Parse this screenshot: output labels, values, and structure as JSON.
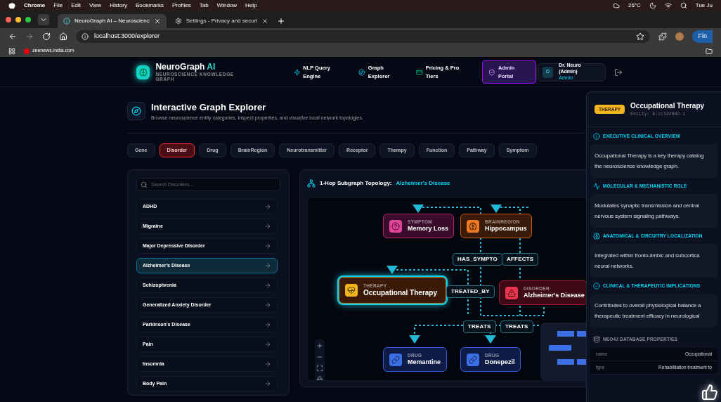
{
  "menubar": {
    "app": "Chrome",
    "items": [
      "File",
      "Edit",
      "View",
      "History",
      "Bookmarks",
      "Profiles",
      "Tab",
      "Window",
      "Help"
    ],
    "weather": "26°C",
    "clock": "Tue Ju"
  },
  "tabs": [
    {
      "title": "NeuroGraph AI – Neuroscienc",
      "selected": true
    },
    {
      "title": "Settings - Privacy and securi",
      "selected": false
    }
  ],
  "address": "localhost:3000/explorer",
  "bookmarks": [
    "zeenews.india.com"
  ],
  "profile_button": "Fin",
  "brand": {
    "name": "NeuroGraph",
    "accent": "AI",
    "tagline": "NEUROSCIENCE KNOWLEDGE GRAPH"
  },
  "nav": [
    {
      "label": "NLP Query Engine",
      "kind": "nlp"
    },
    {
      "label": "Graph Explorer",
      "kind": "graph"
    },
    {
      "label": "Pricing & Pro Tiers",
      "kind": "pricing"
    },
    {
      "label": "Admin Portal",
      "kind": "admin"
    }
  ],
  "user": {
    "initial": "D",
    "name": "Dr. Neuro (Admin)",
    "role": "Admin"
  },
  "page": {
    "title": "Interactive Graph Explorer",
    "subtitle": "Browse neuroscience entity categories, inspect properties, and visualize local network topologies."
  },
  "categories": [
    {
      "label": "Gene",
      "selected": false
    },
    {
      "label": "Disorder",
      "selected": true
    },
    {
      "label": "Drug",
      "selected": false
    },
    {
      "label": "BrainRegion",
      "selected": false
    },
    {
      "label": "Neurotransmitter",
      "selected": false
    },
    {
      "label": "Receptor",
      "selected": false
    },
    {
      "label": "Therapy",
      "selected": false
    },
    {
      "label": "Function",
      "selected": false
    },
    {
      "label": "Pathway",
      "selected": false
    },
    {
      "label": "Symptom",
      "selected": false
    }
  ],
  "search": {
    "placeholder": "Search Disorders..."
  },
  "entities": [
    {
      "name": "ADHD",
      "selected": false
    },
    {
      "name": "Migraine",
      "selected": false
    },
    {
      "name": "Major Depressive Disorder",
      "selected": false
    },
    {
      "name": "Alzheimer's Disease",
      "selected": true
    },
    {
      "name": "Schizophrenia",
      "selected": false
    },
    {
      "name": "Generalized Anxiety Disorder",
      "selected": false
    },
    {
      "name": "Parkinson's Disease",
      "selected": false
    },
    {
      "name": "Pain",
      "selected": false
    },
    {
      "name": "Insomnia",
      "selected": false
    },
    {
      "name": "Body Pain",
      "selected": false
    }
  ],
  "graph": {
    "title": "1-Hop Subgraph Topology:",
    "subject": "Alzheimer's Disease",
    "nodes": [
      {
        "type": "SYMPTOM",
        "name": "Memory Loss",
        "kind": "symptom",
        "selected": false
      },
      {
        "type": "BRAINREGION",
        "name": "Hippocampus",
        "kind": "brainregion",
        "selected": false
      },
      {
        "type": "THERAPY",
        "name": "Occupational Therapy",
        "kind": "therapy",
        "selected": true
      },
      {
        "type": "DISORDER",
        "name": "Alzheimer's Disease",
        "kind": "disorder",
        "selected": false
      },
      {
        "type": "DRUG",
        "name": "Memantine",
        "kind": "drug",
        "selected": false
      },
      {
        "type": "DRUG",
        "name": "Donepezil",
        "kind": "drug",
        "selected": false
      }
    ],
    "edge_labels": [
      "HAS_SYMPTO",
      "AFFECTS",
      "TREATED_BY",
      "TREATS",
      "TREATS"
    ]
  },
  "details": {
    "badge": "THERAPY",
    "title": "Occupational Therapy",
    "entity": "Entity: 4:cc3220d2-1",
    "sections": [
      {
        "kind": "info",
        "heading": "EXECUTIVE CLINICAL OVERVIEW",
        "lines": [
          "Occupational Therapy is a key therapy catalog",
          "the neuroscience knowledge graph."
        ]
      },
      {
        "kind": "activity",
        "heading": "MOLECULAR & MECHANISTIC ROLE",
        "lines": [
          "Modulates synaptic transmission and central",
          "nervous system signaling pathways."
        ]
      },
      {
        "kind": "brain",
        "heading": "ANATOMICAL & CIRCUITRY LOCALIZATION",
        "lines": [
          "Integrated within fronto-limbic and subcortica",
          "neural networks."
        ]
      },
      {
        "kind": "check",
        "heading": "CLINICAL & THERAPEUTIC IMPLICATIONS",
        "lines": [
          "Contributes to overall physiological balance a",
          "therapeutic treatment efficacy in neurological"
        ]
      }
    ],
    "properties_heading": "NEO4J DATABASE PROPERTIES",
    "properties": [
      {
        "key": "name",
        "value": "Occupational"
      },
      {
        "key": "type",
        "value": "Rehabilitation treatment to"
      }
    ]
  }
}
